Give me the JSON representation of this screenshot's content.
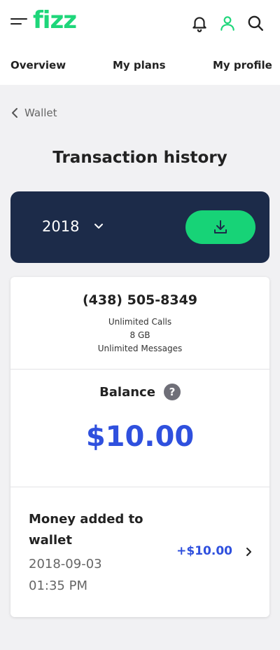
{
  "header": {
    "logo_text": "fizz",
    "icons": [
      "menu-icon",
      "bell-icon",
      "user-icon",
      "search-icon"
    ],
    "accent_color": "#1ed67a"
  },
  "nav": {
    "items": [
      {
        "label": "Overview"
      },
      {
        "label": "My plans"
      },
      {
        "label": "My profile"
      }
    ]
  },
  "breadcrumb": {
    "back_label": "Wallet"
  },
  "page": {
    "title": "Transaction history"
  },
  "year_filter": {
    "selected": "2018",
    "card_color": "#1c2b49",
    "download_color": "#17d377"
  },
  "plan": {
    "phone": "(438) 505-8349",
    "features": [
      "Unlimited Calls",
      "8 GB",
      "Unlimited Messages"
    ]
  },
  "balance": {
    "label": "Balance",
    "help": "?",
    "amount": "$10.00",
    "amount_color": "#2f50de"
  },
  "transactions": [
    {
      "title": "Money added to wallet",
      "date": "2018-09-03",
      "time": "01:35 PM",
      "amount": "+$10.00"
    }
  ]
}
